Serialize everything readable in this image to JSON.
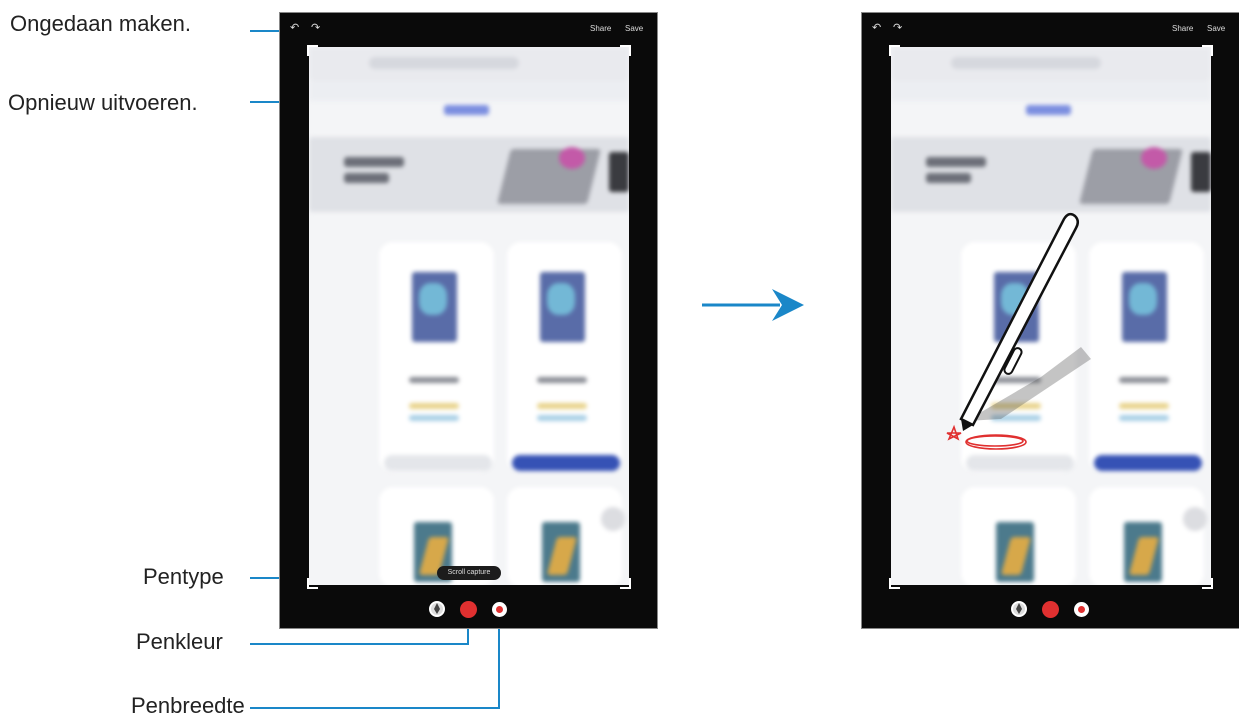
{
  "callouts": {
    "undo": "Ongedaan maken.",
    "redo": "Opnieuw uitvoeren.",
    "pen_type": "Pentype",
    "pen_color": "Penkleur",
    "pen_width": "Penbreedte"
  },
  "toolbar": {
    "share_label": "Share",
    "save_label": "Save",
    "undo_icon": "↶",
    "redo_icon": "↷"
  },
  "scroll_capture_label": "Scroll capture",
  "colors": {
    "callout_line": "#1a87c8",
    "pen_color": "#e03030",
    "arrow": "#1a87c8"
  }
}
